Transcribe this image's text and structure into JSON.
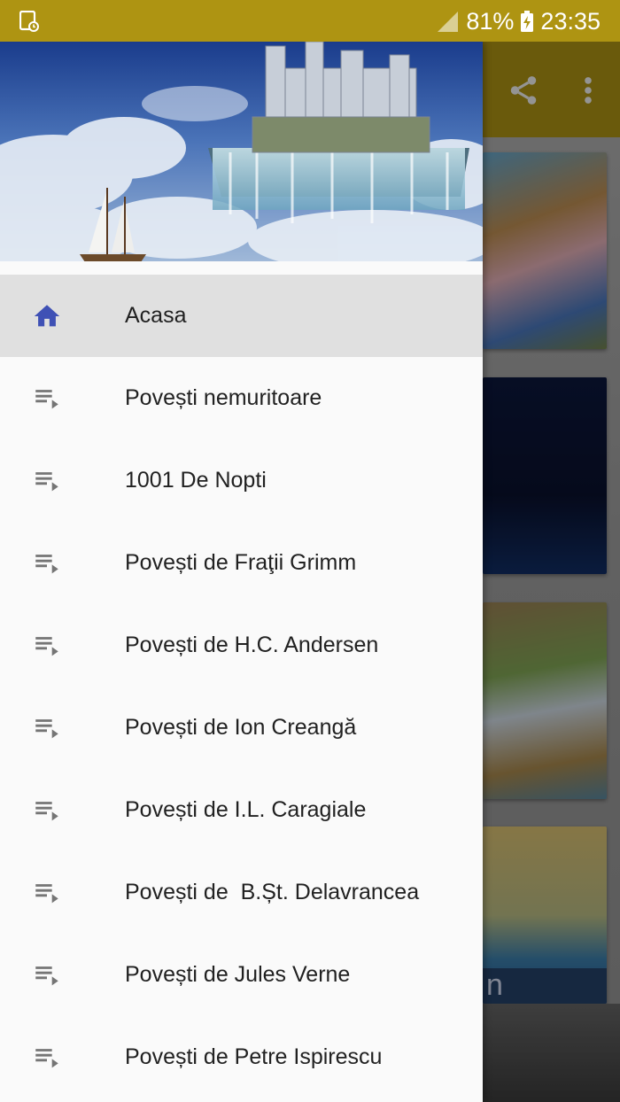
{
  "status_bar": {
    "battery": "81%",
    "time": "23:35",
    "background_color": "#ae9412"
  },
  "toolbar": {
    "share_icon": "share-icon",
    "more_icon": "more-vert-icon"
  },
  "drawer": {
    "header_image": "castle-in-clouds-illustration",
    "accent_color": "#3f51b5",
    "items": [
      {
        "label": "Acasa",
        "icon": "home-icon",
        "active": true
      },
      {
        "label": "Povești nemuritoare",
        "icon": "playlist-icon"
      },
      {
        "label": "1001 De Nopti",
        "icon": "playlist-icon"
      },
      {
        "label": "Povești de Fraţii Grimm",
        "icon": "playlist-icon"
      },
      {
        "label": "Povești de H.C. Andersen",
        "icon": "playlist-icon"
      },
      {
        "label": "Povești de Ion Creangă",
        "icon": "playlist-icon"
      },
      {
        "label": "Povești de I.L. Caragiale",
        "icon": "playlist-icon"
      },
      {
        "label": "Povești de  B.Șt. Delavrancea",
        "icon": "playlist-icon"
      },
      {
        "label": "Povești de Jules Verne",
        "icon": "playlist-icon"
      },
      {
        "label": "Povești de Petre Ispirescu",
        "icon": "playlist-icon"
      }
    ]
  },
  "background_cards": [
    {
      "image": "pig-cottage-illustration"
    },
    {
      "image": "night-blue-illustration"
    },
    {
      "image": "waterfall-forest-illustration"
    },
    {
      "image": "reeds-water-illustration",
      "caption_fragment": "n"
    }
  ]
}
